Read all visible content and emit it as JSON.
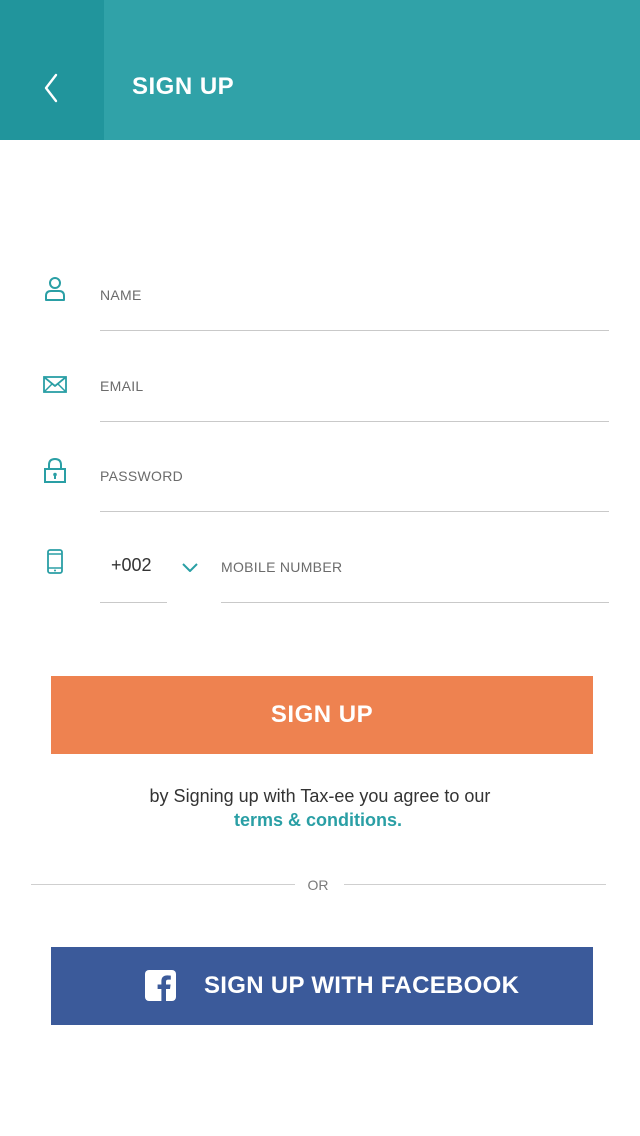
{
  "header": {
    "title": "SIGN UP",
    "back_icon": "chevron-left-icon"
  },
  "form": {
    "name": {
      "placeholder": "NAME",
      "icon": "user-icon"
    },
    "email": {
      "placeholder": "EMAIL",
      "icon": "envelope-icon"
    },
    "password": {
      "placeholder": "PASSWORD",
      "icon": "lock-icon"
    },
    "mobile": {
      "placeholder": "MOBILE NUMBER",
      "icon": "mobile-phone-icon",
      "country_code": "+002"
    }
  },
  "signup_button": {
    "label": "SIGN UP"
  },
  "terms": {
    "text": "by Signing up with Tax-ee you agree to our",
    "link": "terms & conditions."
  },
  "divider": {
    "label": "OR"
  },
  "facebook_button": {
    "label": "SIGN UP WITH FACEBOOK",
    "icon": "facebook-icon"
  },
  "colors": {
    "header": "#30a2a8",
    "header_back": "#21959c",
    "accent": "#2a9fa5",
    "signup": "#ee8250",
    "facebook": "#3b5a9a"
  }
}
